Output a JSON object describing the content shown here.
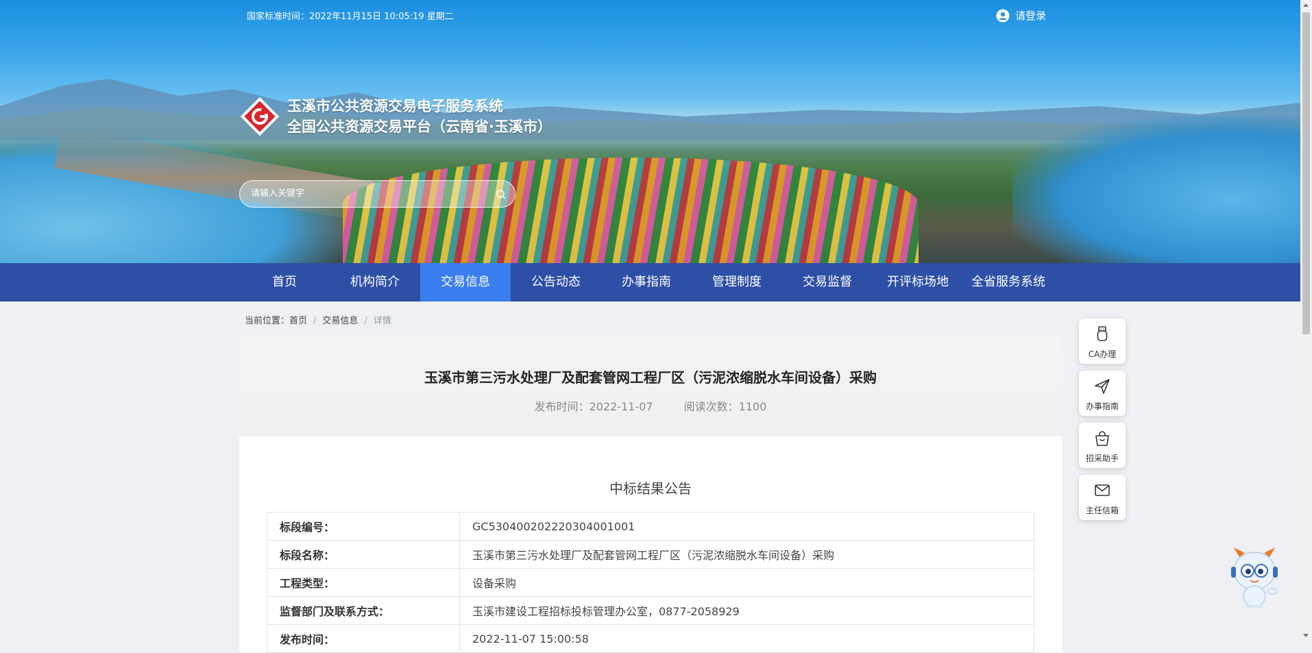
{
  "header": {
    "time_label": "国家标准时间：2022年11月15日 10:05:19 星期二",
    "login_label": "请登录",
    "logo_line1": "玉溪市公共资源交易电子服务系统",
    "logo_line2": "全国公共资源交易平台（云南省·玉溪市）",
    "search_placeholder": "请输入关键字"
  },
  "nav": {
    "items": [
      {
        "label": "首页"
      },
      {
        "label": "机构简介"
      },
      {
        "label": "交易信息"
      },
      {
        "label": "公告动态"
      },
      {
        "label": "办事指南"
      },
      {
        "label": "管理制度"
      },
      {
        "label": "交易监督"
      },
      {
        "label": "开评标场地"
      },
      {
        "label": "全省服务系统"
      }
    ],
    "active_index": 2
  },
  "breadcrumb": {
    "prefix": "当前位置：",
    "home": "首页",
    "sep": "/",
    "section": "交易信息",
    "current": "详情"
  },
  "article": {
    "title": "玉溪市第三污水处理厂及配套管网工程厂区（污泥浓缩脱水车间设备）采购",
    "publish_time": "发布时间：2022-11-07",
    "read_count": "阅读次数：1100",
    "notice_title": "中标结果公告",
    "rows": [
      {
        "key": "标段编号：",
        "value": "GC5304002022203040010​01"
      },
      {
        "key": "标段名称：",
        "value": "玉溪市第三污水处理厂及配套管网工程厂区（污泥浓缩脱水车间设备）采购"
      },
      {
        "key": "工程类型：",
        "value": "设备采购"
      },
      {
        "key": "监督部门及联系方式：",
        "value": "玉溪市建设工程招标投标管理办公室，0877-2058929"
      },
      {
        "key": "发布时间：",
        "value": "2022-11-07 15:00:58"
      }
    ]
  },
  "tools": [
    {
      "label": "CA办理",
      "icon": "usb-key-icon"
    },
    {
      "label": "办事指南",
      "icon": "paper-plane-icon"
    },
    {
      "label": "招采助手",
      "icon": "shopping-bag-icon"
    },
    {
      "label": "主任信箱",
      "icon": "mail-icon"
    }
  ],
  "colors": {
    "nav_bg": "#2d4fa6",
    "nav_active": "#3a7eef",
    "logo_red": "#d7262e"
  }
}
